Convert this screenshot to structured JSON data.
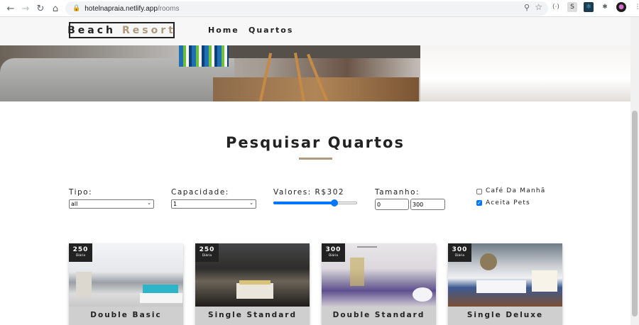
{
  "browser": {
    "url_host": "hotelnapraia.netlify.app",
    "url_path": "/rooms"
  },
  "site": {
    "logo_word1": "Beach",
    "logo_word2": "Resort",
    "nav": [
      "Home",
      "Quartos"
    ]
  },
  "search": {
    "title": "Pesquisar Quartos",
    "tipo_label": "Tipo:",
    "tipo_value": "all",
    "capacidade_label": "Capacidade:",
    "capacidade_value": "1",
    "valores_label": "Valores: R$302",
    "valores_fraction": 0.73,
    "tamanho_label": "Tamanho:",
    "tamanho_min": "0",
    "tamanho_max": "300",
    "cafe_label": "Café Da Manhã",
    "cafe_checked": false,
    "pets_label": "Aceita Pets",
    "pets_checked": true
  },
  "rooms": [
    {
      "price": "250",
      "per": "Diária",
      "name": "Double Basic"
    },
    {
      "price": "250",
      "per": "Diária",
      "name": "Single Standard"
    },
    {
      "price": "300",
      "per": "Diária",
      "name": "Double Standard"
    },
    {
      "price": "300",
      "per": "Diária",
      "name": "Single Deluxe"
    }
  ],
  "colors": {
    "accent": "#af9a7d",
    "range": "#0075ff"
  }
}
